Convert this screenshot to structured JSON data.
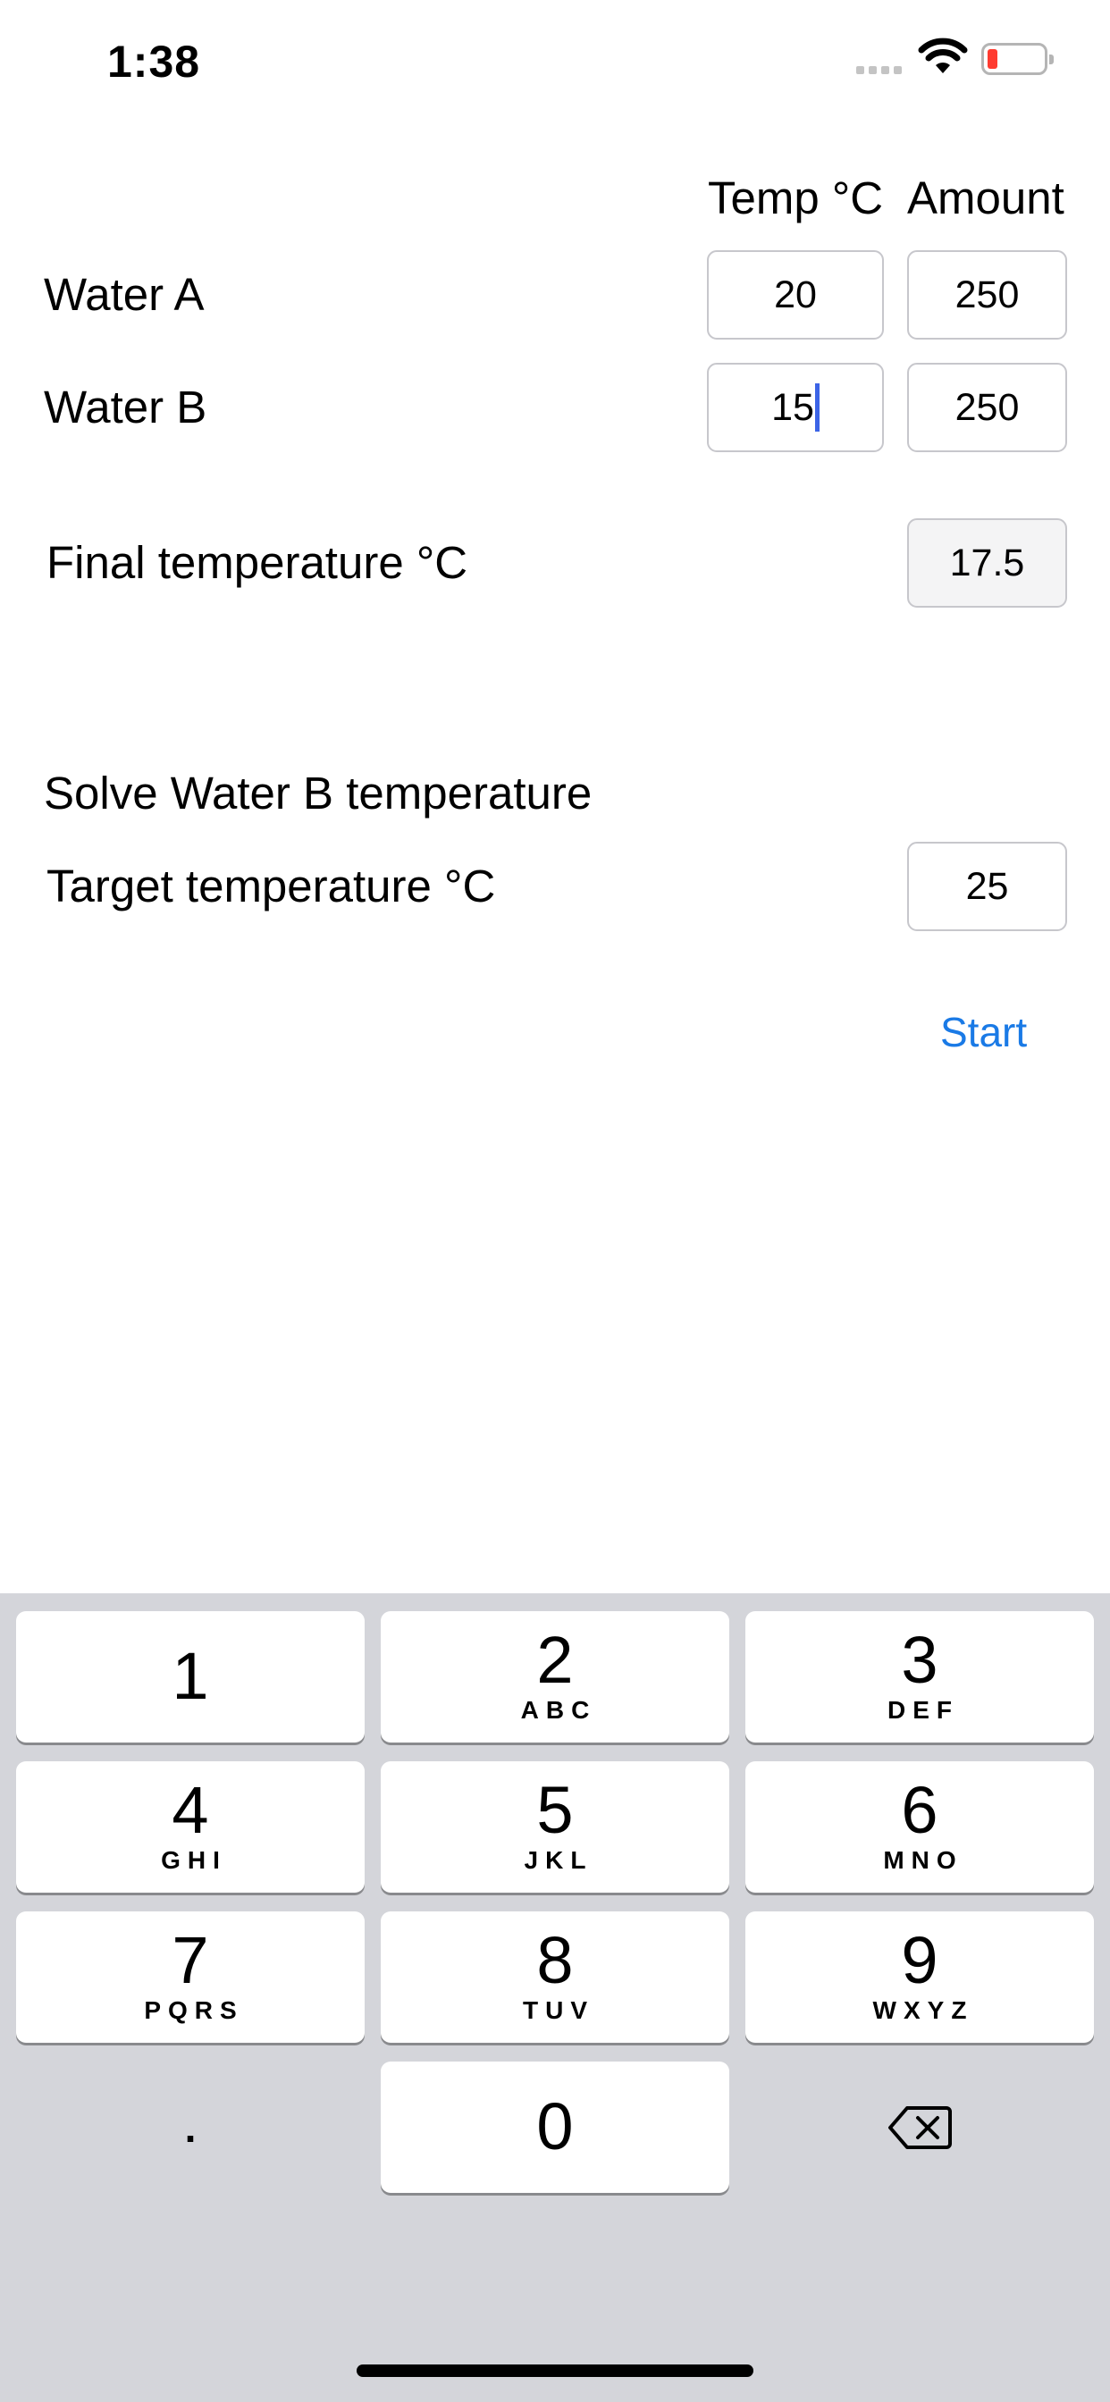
{
  "status_bar": {
    "time": "1:38",
    "battery_color": "#ff3b30"
  },
  "form": {
    "col_temp": "Temp °C",
    "col_amount": "Amount",
    "water_a": {
      "label": "Water A",
      "temp": "20",
      "amount": "250"
    },
    "water_b": {
      "label": "Water B",
      "temp": "15",
      "amount": "250"
    },
    "final_label": "Final temperature °C",
    "final_value": "17.5",
    "solve_title": "Solve Water B temperature",
    "target_label": "Target temperature °C",
    "target_value": "25",
    "start_label": "Start",
    "accent_color": "#1a7ae6"
  },
  "keypad": {
    "keys": [
      {
        "digit": "1",
        "letters": ""
      },
      {
        "digit": "2",
        "letters": "ABC"
      },
      {
        "digit": "3",
        "letters": "DEF"
      },
      {
        "digit": "4",
        "letters": "GHI"
      },
      {
        "digit": "5",
        "letters": "JKL"
      },
      {
        "digit": "6",
        "letters": "MNO"
      },
      {
        "digit": "7",
        "letters": "PQRS"
      },
      {
        "digit": "8",
        "letters": "TUV"
      },
      {
        "digit": "9",
        "letters": "WXYZ"
      },
      {
        "digit": "0",
        "letters": ""
      }
    ],
    "decimal": ".",
    "delete_icon": "backspace-icon"
  }
}
